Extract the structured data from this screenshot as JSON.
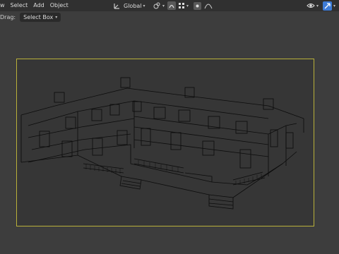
{
  "header": {
    "menus": [
      "w",
      "Select",
      "Add",
      "Object"
    ],
    "transform_orientation": "Global"
  },
  "toolbar": {
    "drag_label": "Drag:",
    "select_mode": "Select Box"
  },
  "colors": {
    "header_bg": "#303030",
    "viewport_bg": "#3d3d3d",
    "camera_frame": "#b9b13a",
    "wireframe": "#0c0c0c",
    "active_blue": "#3d7bd6"
  },
  "icons": [
    "orientation-icon",
    "snap-icon",
    "proportional-edit-icon",
    "pivot-icon",
    "overlay-icon",
    "gizmo-icon"
  ]
}
